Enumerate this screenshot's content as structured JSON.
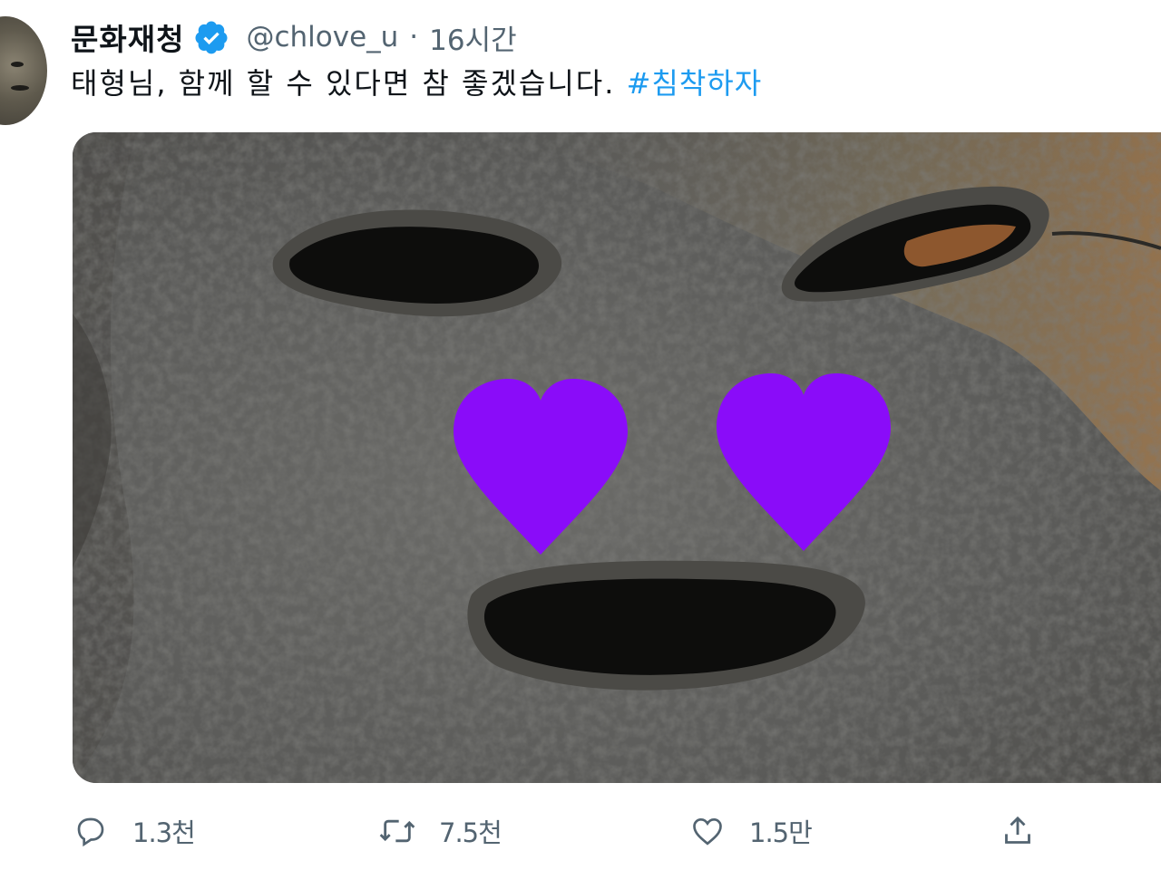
{
  "tweet": {
    "display_name": "문화재청",
    "verified": true,
    "handle": "@chlove_u",
    "separator": "·",
    "time": "16시간",
    "text": "태형님, 함께 할 수 있다면 참 좋겠습니다.",
    "hashtag": "#침착하자",
    "media_icons": [
      "heart-icon",
      "heart-icon"
    ]
  },
  "actions": {
    "reply": {
      "icon": "reply-icon",
      "count": "1.3천"
    },
    "retweet": {
      "icon": "retweet-icon",
      "count": "7.5천"
    },
    "like": {
      "icon": "like-icon",
      "count": "1.5만"
    },
    "share": {
      "icon": "share-icon"
    }
  },
  "colors": {
    "text": "#0f1419",
    "secondary": "#536471",
    "accent": "#1d9bf0",
    "heart": "#8a0cf9"
  }
}
